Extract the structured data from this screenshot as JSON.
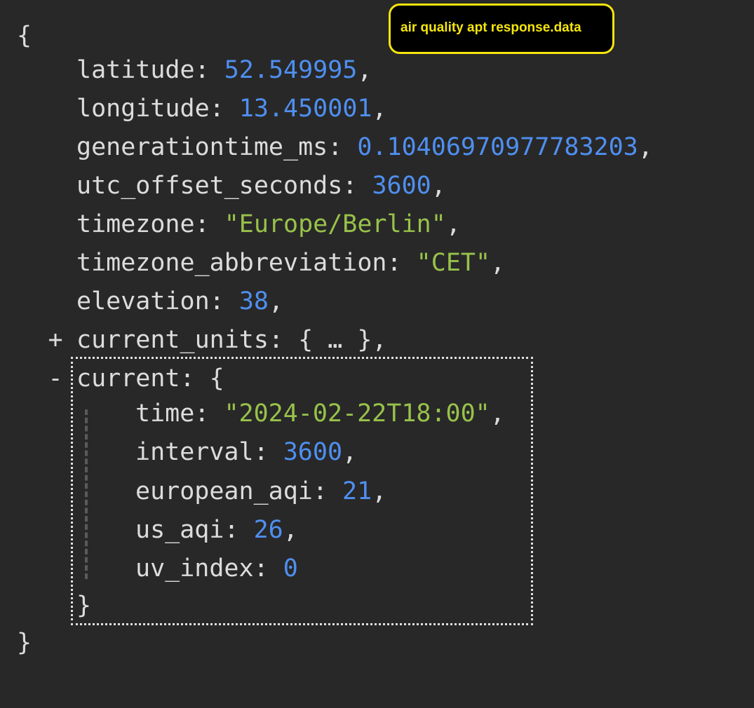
{
  "annotation": "air quality apt response.data",
  "root_open": "{",
  "root_close": "}",
  "fields": [
    {
      "key": "latitude",
      "value": "52.549995",
      "type": "number"
    },
    {
      "key": "longitude",
      "value": "13.450001",
      "type": "number"
    },
    {
      "key": "generationtime_ms",
      "value": "0.10406970977783203",
      "type": "number"
    },
    {
      "key": "utc_offset_seconds",
      "value": "3600",
      "type": "number"
    },
    {
      "key": "timezone",
      "value": "\"Europe/Berlin\"",
      "type": "string"
    },
    {
      "key": "timezone_abbreviation",
      "value": "\"CET\"",
      "type": "string"
    },
    {
      "key": "elevation",
      "value": "38",
      "type": "number"
    }
  ],
  "current_units": {
    "toggle": "+",
    "key": "current_units",
    "collapsed_preview": "{ … },"
  },
  "current": {
    "toggle": "-",
    "key": "current",
    "open": "{",
    "close": "}",
    "fields": [
      {
        "key": "time",
        "value": "\"2024-02-22T18:00\"",
        "type": "string"
      },
      {
        "key": "interval",
        "value": "3600",
        "type": "number"
      },
      {
        "key": "european_aqi",
        "value": "21",
        "type": "number"
      },
      {
        "key": "us_aqi",
        "value": "26",
        "type": "number"
      },
      {
        "key": "uv_index",
        "value": "0",
        "type": "number"
      }
    ]
  },
  "colors": {
    "background": "#282828",
    "key": "#dcdcdc",
    "number": "#4f8ff0",
    "string": "#98c24a",
    "annotation": "#f5e50e"
  }
}
